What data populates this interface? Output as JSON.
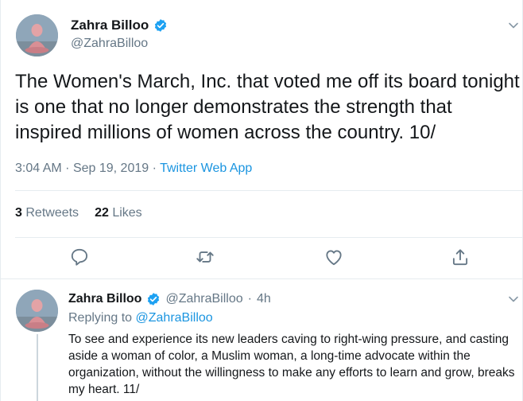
{
  "main_tweet": {
    "author": {
      "name": "Zahra Billoo",
      "handle": "@ZahraBilloo",
      "verified": true
    },
    "text": "The Women's March, Inc. that voted me off its board tonight is one that no longer demonstrates the strength that inspired millions of women across the country. 10/",
    "time": "3:04 AM",
    "date": "Sep 19, 2019",
    "separator": "·",
    "source": "Twitter Web App",
    "retweets_count": "3",
    "retweets_label": "Retweets",
    "likes_count": "22",
    "likes_label": "Likes"
  },
  "reply_tweet": {
    "author": {
      "name": "Zahra Billoo",
      "handle": "@ZahraBilloo",
      "verified": true
    },
    "separator": "·",
    "time_ago": "4h",
    "replying_prefix": "Replying to",
    "replying_to": "@ZahraBilloo",
    "text": "To see and experience its new leaders caving to right-wing pressure, and casting aside a woman of color, a Muslim woman, a long-time advocate within the organization, without the willingness to make any efforts to learn and grow, breaks my heart. 11/"
  },
  "icons": {
    "verified": "verified-badge-icon",
    "caret": "chevron-down-icon",
    "reply": "reply-icon",
    "retweet": "retweet-icon",
    "like": "heart-icon",
    "share": "share-icon"
  },
  "colors": {
    "link_blue": "#1b95e0",
    "secondary_text": "#657786",
    "primary_text": "#14171a",
    "divider": "#e6ecf0"
  }
}
